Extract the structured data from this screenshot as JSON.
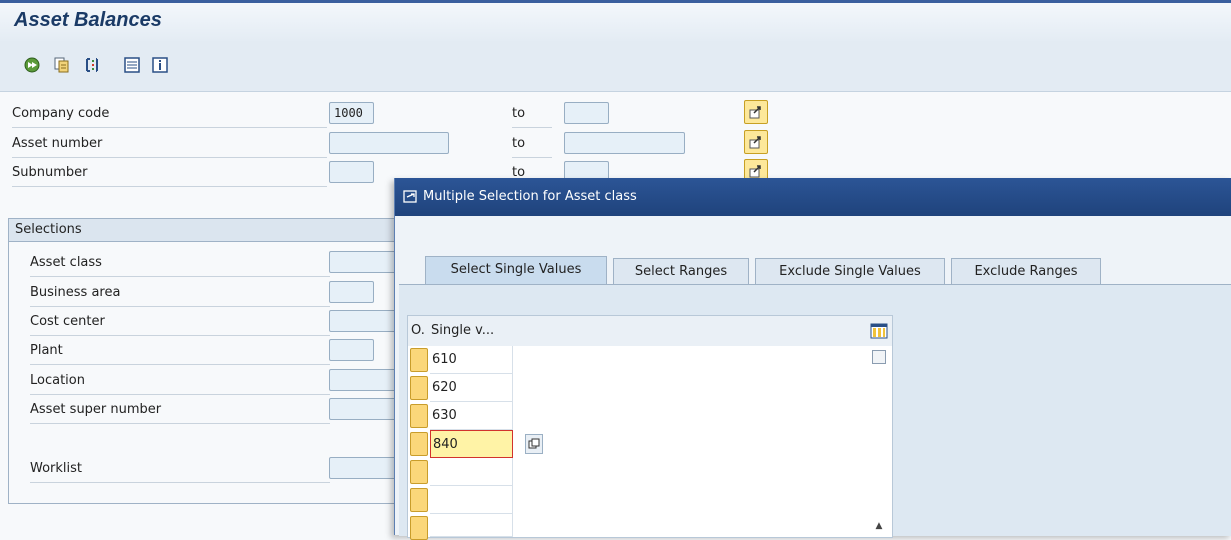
{
  "header": {
    "title": "Asset Balances"
  },
  "toolbar": {
    "icons": [
      "execute-icon",
      "get-variant-icon",
      "selection-options-icon",
      "dynamic-selections-icon",
      "info-icon"
    ]
  },
  "form": {
    "company_code": {
      "label": "Company code",
      "value": "1000",
      "to_label": "to",
      "to_value": ""
    },
    "asset_number": {
      "label": "Asset number",
      "value": "",
      "to_label": "to",
      "to_value": ""
    },
    "subnumber": {
      "label": "Subnumber",
      "value": "",
      "to_label": "to",
      "to_value": ""
    }
  },
  "selections": {
    "header": "Selections",
    "fields": {
      "asset_class": "Asset class",
      "business_area": "Business area",
      "cost_center": "Cost center",
      "plant": "Plant",
      "location": "Location",
      "asset_super_number": "Asset super number",
      "worklist": "Worklist"
    }
  },
  "dialog": {
    "title": "Multiple Selection for Asset class",
    "tabs": {
      "select_single": "Select Single Values",
      "select_ranges": "Select Ranges",
      "exclude_single": "Exclude Single Values",
      "exclude_ranges": "Exclude Ranges"
    },
    "active_tab": "Select Single Values",
    "table": {
      "col_option": "O.",
      "col_single": "Single v...",
      "rows": {
        "r0": "610",
        "r1": "620",
        "r2": "630",
        "r3": "840",
        "r4": "",
        "r5": "",
        "r6": ""
      }
    }
  },
  "colors": {
    "title": "#1a3a66",
    "dialog_title_bg": "#2c5596",
    "input_bg": "#e6f0f8",
    "multisel_btn": "#fde89a",
    "editing_cell": "#fff3a6"
  }
}
